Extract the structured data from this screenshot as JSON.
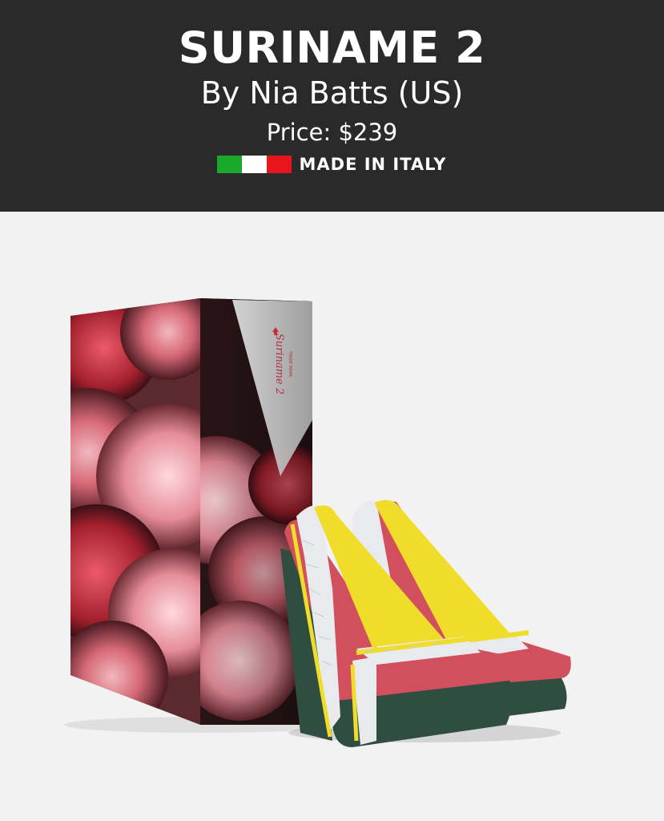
{
  "product": {
    "title": "SURINAME 2",
    "byline": "By Nia Batts (US)",
    "price": "Price: $239",
    "origin_badge": "MADE IN ITALY",
    "flag_colors": [
      "#1aa82b",
      "#ffffff",
      "#e8161b"
    ]
  },
  "box": {
    "label_name": "Suriname 2",
    "label_sub": "TRADE MARK"
  },
  "colors": {
    "header_bg": "#2a2a2a",
    "page_bg": "#f2f2f2",
    "shoe_pink": "#d2505e",
    "shoe_yellow": "#f0dc2a",
    "shoe_green": "#2f4d40",
    "shoe_white": "#e9eaee"
  }
}
